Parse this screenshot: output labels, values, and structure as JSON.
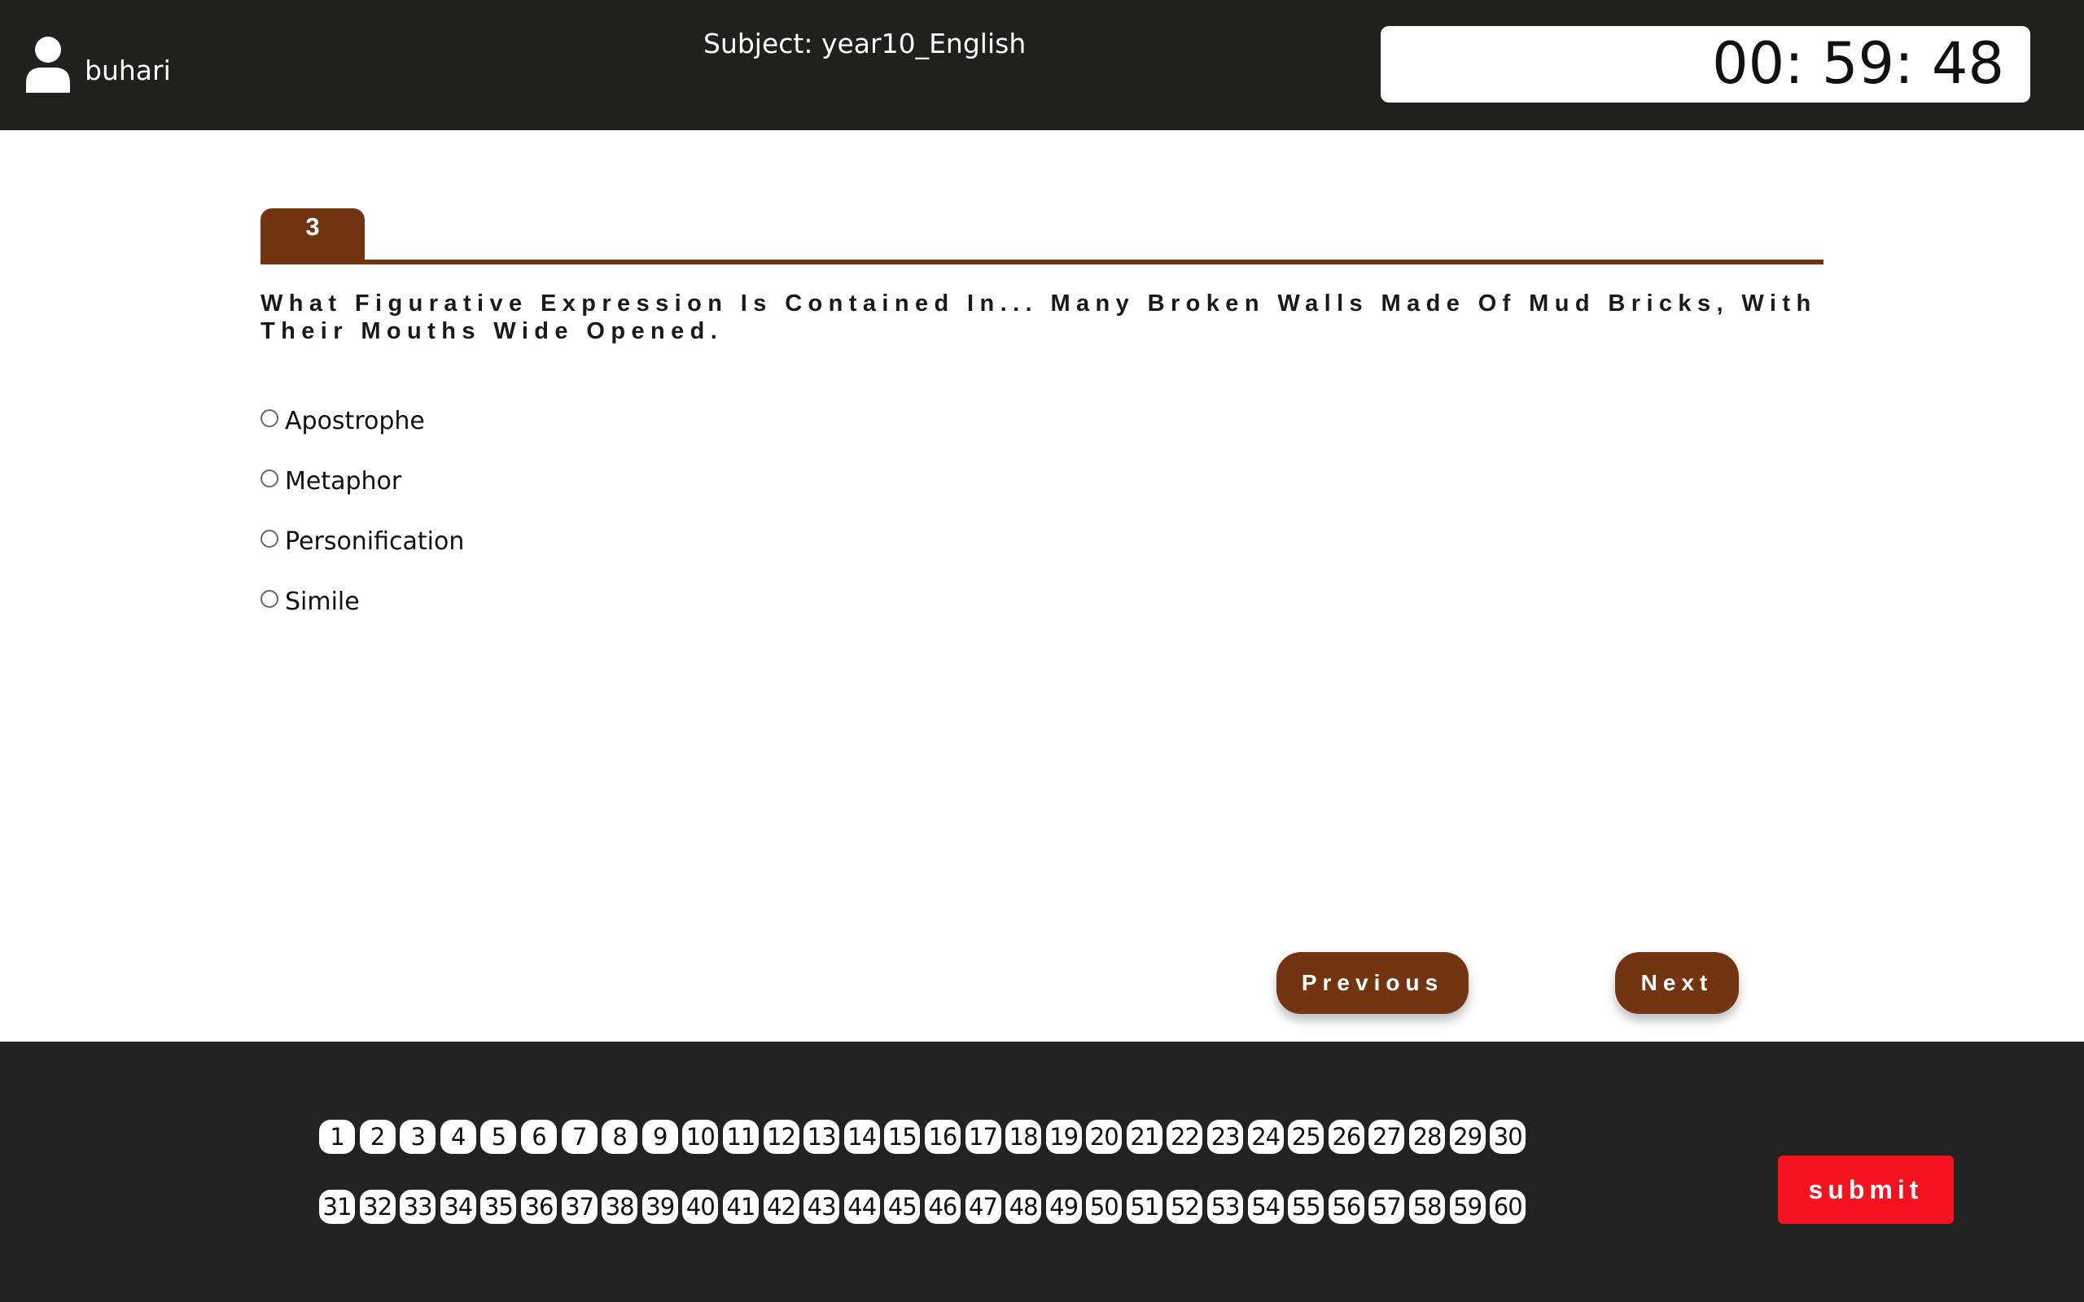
{
  "header": {
    "username": "buhari",
    "subject": "Subject: year10_English",
    "timer": "00: 59: 48"
  },
  "question": {
    "number": "3",
    "text": "What Figurative Expression Is Contained In... Many Broken Walls Made Of Mud Bricks, With Their Mouths Wide Opened.",
    "options": [
      "Apostrophe",
      "Metaphor",
      "Personification",
      "Simile"
    ]
  },
  "navigation": {
    "previous_label": "Previous",
    "next_label": "Next"
  },
  "footer": {
    "question_numbers_row1": [
      "1",
      "2",
      "3",
      "4",
      "5",
      "6",
      "7",
      "8",
      "9",
      "10",
      "11",
      "12",
      "13",
      "14",
      "15",
      "16",
      "17",
      "18",
      "19",
      "20",
      "21",
      "22",
      "23",
      "24",
      "25",
      "26",
      "27",
      "28",
      "29",
      "30"
    ],
    "question_numbers_row2": [
      "31",
      "32",
      "33",
      "34",
      "35",
      "36",
      "37",
      "38",
      "39",
      "40",
      "41",
      "42",
      "43",
      "44",
      "45",
      "46",
      "47",
      "48",
      "49",
      "50",
      "51",
      "52",
      "53",
      "54",
      "55",
      "56",
      "57",
      "58",
      "59",
      "60"
    ],
    "submit_label": "submit"
  },
  "colors": {
    "header_bg": "#20201e",
    "accent_brown": "#733511",
    "footer_bg": "#222222",
    "submit_red": "#f5121f"
  }
}
